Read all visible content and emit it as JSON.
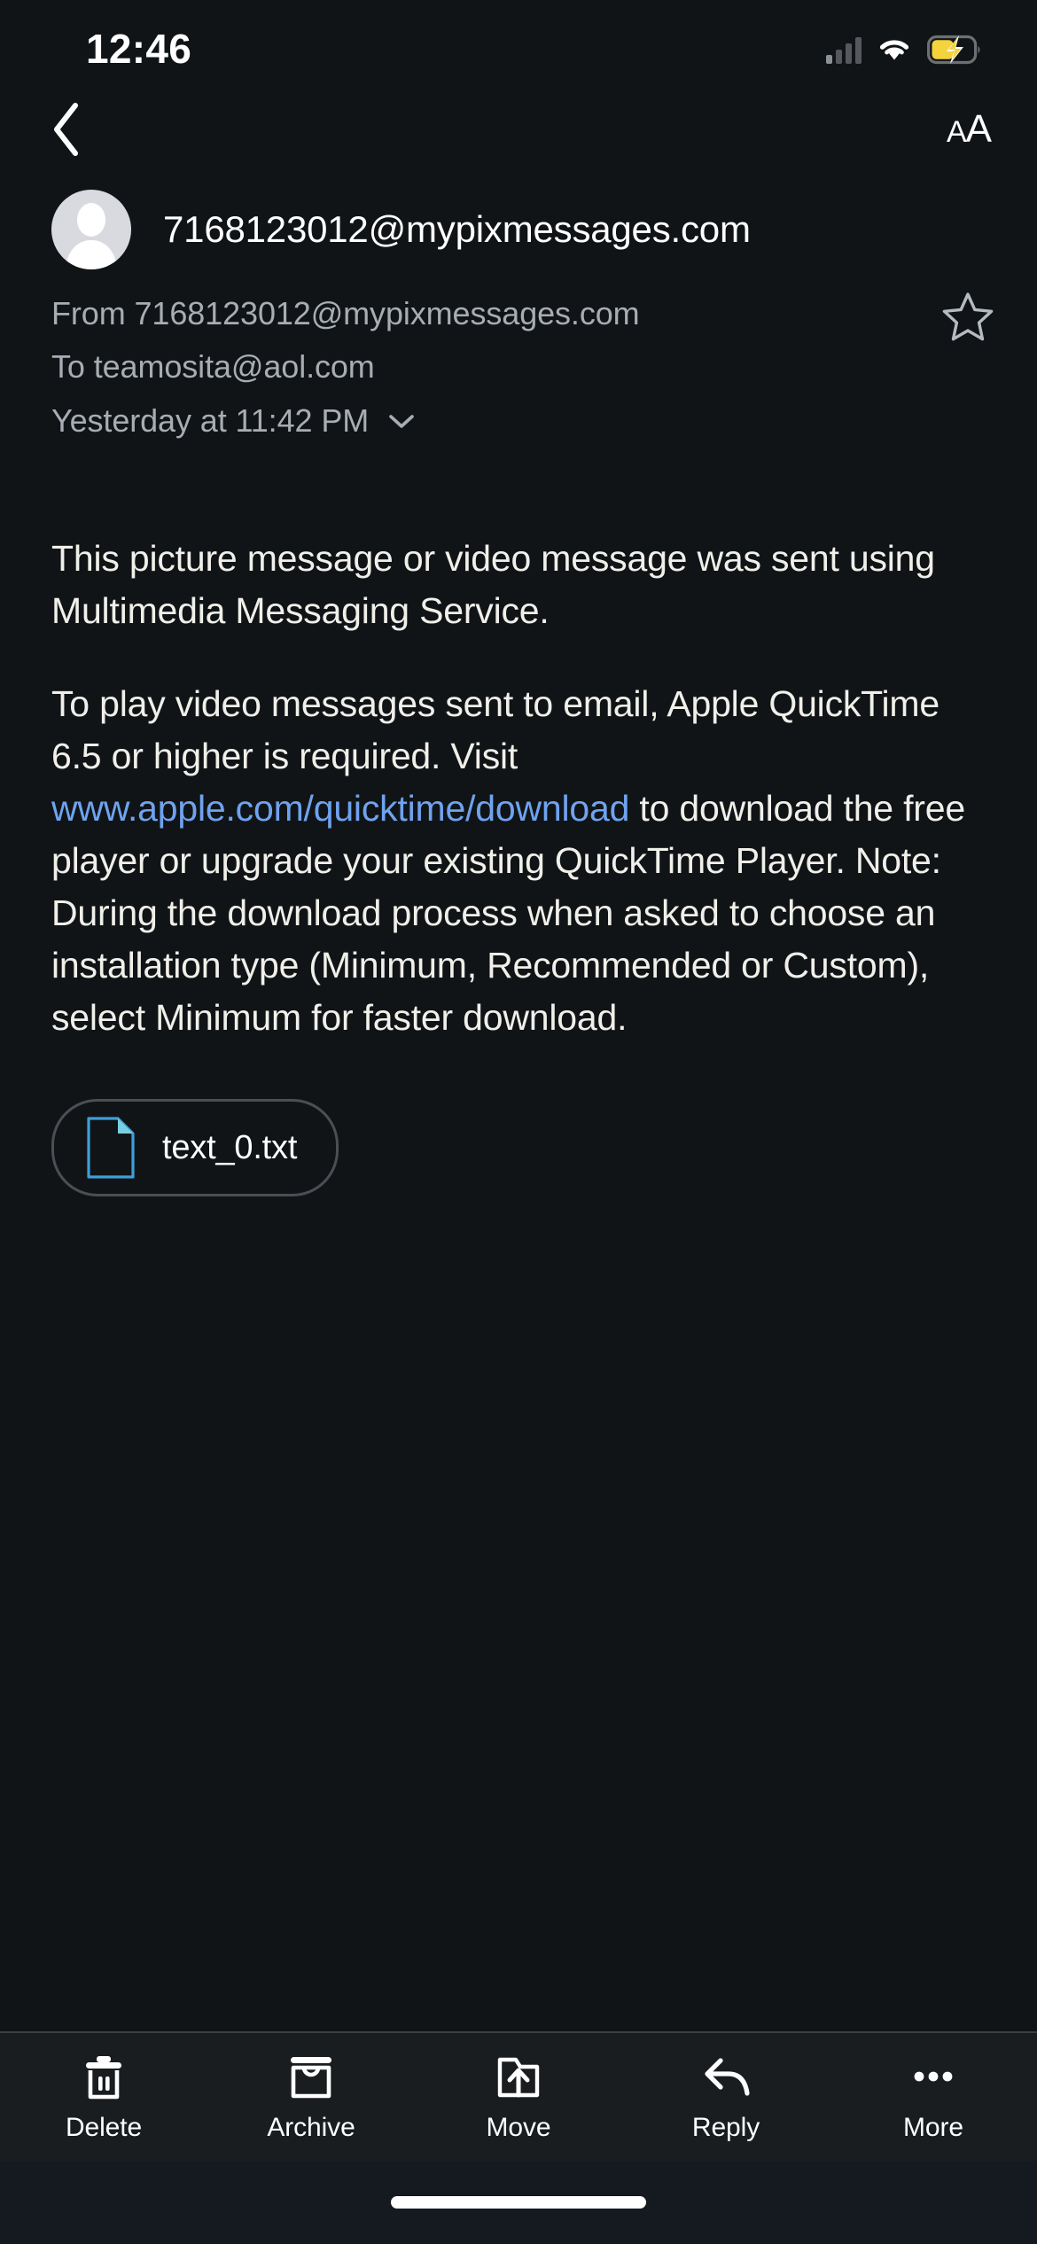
{
  "status_bar": {
    "time": "12:46",
    "signal_icon": "cellular-signal-icon",
    "signal_bars_total": 4,
    "signal_bars_active": 1,
    "wifi_icon": "wifi-icon",
    "battery_icon": "battery-charging-icon",
    "battery_color": "#f5d33d",
    "battery_level_percent": 50,
    "charging": true
  },
  "nav_bar": {
    "back_icon": "chevron-left-icon",
    "text_size_label_large": "A",
    "text_size_label_small": "A"
  },
  "header": {
    "avatar_icon": "person-placeholder-avatar",
    "sender": "7168123012@mypixmessages.com",
    "from_line": "From 7168123012@mypixmessages.com",
    "to_line": "To teamosita@aol.com",
    "date_line": "Yesterday at 11:42 PM",
    "disclosure_icon": "chevron-down-icon",
    "star_icon": "star-outline-icon"
  },
  "body": {
    "paragraph_1": "This picture message or video message was sent using Multimedia Messaging Service.",
    "paragraph_2_before_link": "To play video messages sent to email, Apple QuickTime 6.5 or higher is required. Visit ",
    "link_text": "www.apple.com/quicktime/download",
    "link_color": "#6fa3ef",
    "paragraph_2_after_link": " to download the free player or upgrade your existing QuickTime Player. Note: During the download process when asked to choose an installation type (Minimum, Recommended or Custom), select Minimum for faster download."
  },
  "attachment": {
    "file_icon": "document-file-icon",
    "file_icon_color": "#4aa9e0",
    "filename": "text_0.txt"
  },
  "toolbar": {
    "items": [
      {
        "label": "Delete",
        "icon": "trash-icon"
      },
      {
        "label": "Archive",
        "icon": "archive-box-icon"
      },
      {
        "label": "Move",
        "icon": "move-to-folder-icon"
      },
      {
        "label": "Reply",
        "icon": "reply-arrow-icon"
      },
      {
        "label": "More",
        "icon": "ellipsis-icon"
      }
    ]
  },
  "home_bar": {
    "indicator": "home-indicator"
  }
}
